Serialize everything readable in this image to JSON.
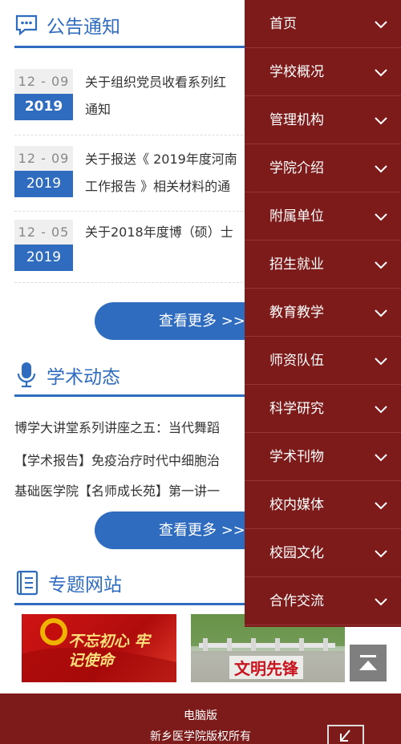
{
  "notices": {
    "title": "公告通知",
    "items": [
      {
        "md": "12 - 09",
        "year": "2019",
        "text_line1": "关于组织党员收看系列红",
        "text_line2": "通知"
      },
      {
        "md": "12 - 09",
        "year": "2019",
        "text_line1": "关于报送《 2019年度河南",
        "text_line2": "工作报告 》相关材料的通"
      },
      {
        "md": "12 - 05",
        "year": "2019",
        "text_line1": "关于2018年度博（硕）士",
        "text_line2": ""
      }
    ],
    "more_label": "查看更多 >>"
  },
  "academic": {
    "title": "学术动态",
    "items": [
      "博学大讲堂系列讲座之五：当代舞蹈",
      "【学术报告】免疫治疗时代中细胞治",
      "基础医学院【名师成长苑】第一讲一"
    ],
    "more_label": "查看更多 >>"
  },
  "topics": {
    "title": "专题网站",
    "banner1_text": "不忘初心 牢记使命",
    "banner2_text": "文明先锋"
  },
  "menu": {
    "items": [
      "首页",
      "学校概况",
      "管理机构",
      "学院介绍",
      "附属单位",
      "招生就业",
      "教育教学",
      "师资队伍",
      "科学研究",
      "学术刊物",
      "校内媒体",
      "校园文化",
      "合作交流"
    ]
  },
  "footer": {
    "pc_version": "电脑版",
    "copyright": "新乡医学院版权所有"
  },
  "icons": {
    "notice": "speech-bubble-icon",
    "academic": "microphone-icon",
    "topics": "document-list-icon",
    "top": "back-to-top-icon",
    "corner": "arrow-down-left-icon"
  },
  "colors": {
    "primary_blue": "#2f6cbf",
    "menu_red": "#7d1b1b"
  }
}
